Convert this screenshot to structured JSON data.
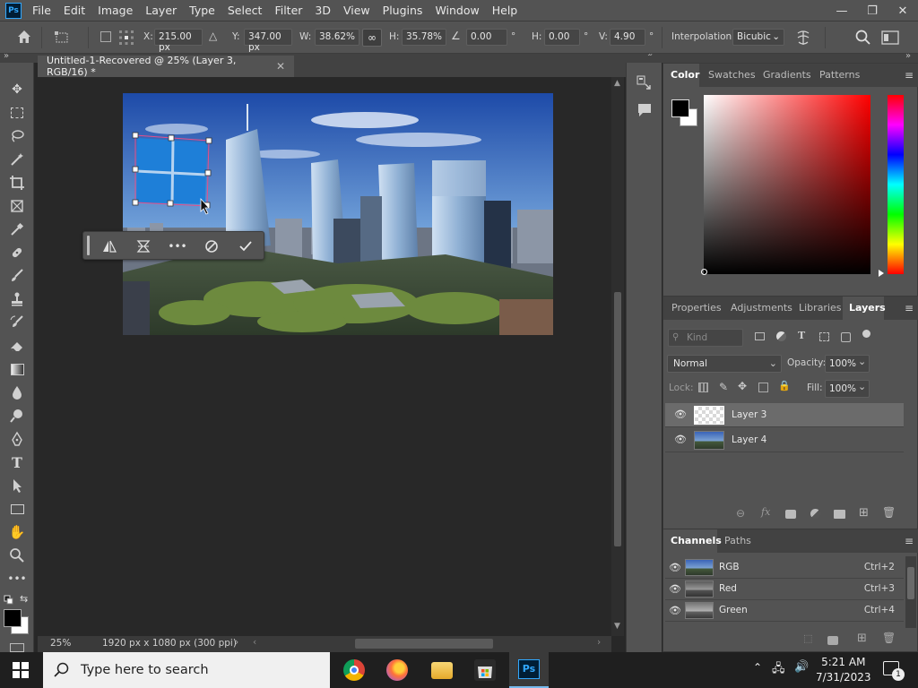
{
  "app": {
    "logo": "Ps"
  },
  "menu": [
    "File",
    "Edit",
    "Image",
    "Layer",
    "Type",
    "Select",
    "Filter",
    "3D",
    "View",
    "Plugins",
    "Window",
    "Help"
  ],
  "window_controls": {
    "minimize": "—",
    "restore": "❐",
    "close": "✕"
  },
  "options": {
    "x_label": "X:",
    "x_value": "215.00 px",
    "y_label": "Y:",
    "y_value": "347.00 px",
    "w_label": "W:",
    "w_value": "38.62%",
    "h_label": "H:",
    "h_value": "35.78%",
    "angle_value": "0.00",
    "deg": "°",
    "hskew_label": "H:",
    "hskew_value": "0.00",
    "vskew_label": "V:",
    "vskew_value": "4.90",
    "interp_label": "Interpolation:",
    "interp_value": "Bicubic"
  },
  "document": {
    "tab_title": "Untitled-1-Recovered @ 25% (Layer 3, RGB/16) *",
    "close": "✕",
    "zoom": "25%",
    "size_info": "1920 px x 1080 px (300 ppi)"
  },
  "context_bar": {
    "icons": [
      "flip-horizontal-icon",
      "warp-icon",
      "more-icon",
      "cancel-icon",
      "commit-icon"
    ]
  },
  "panels": {
    "color_tabs": [
      "Color",
      "Swatches",
      "Gradients",
      "Patterns"
    ],
    "layers_tabs": [
      "Properties",
      "Adjustments",
      "Libraries",
      "Layers"
    ],
    "kind_placeholder": "Kind",
    "blend_mode": "Normal",
    "opacity_label": "Opacity:",
    "opacity_value": "100%",
    "lock_label": "Lock:",
    "fill_label": "Fill:",
    "fill_value": "100%",
    "layers": [
      {
        "name": "Layer 3"
      },
      {
        "name": "Layer 4"
      }
    ],
    "channels_tabs": [
      "Channels",
      "Paths"
    ],
    "channels": [
      {
        "name": "RGB",
        "shortcut": "Ctrl+2"
      },
      {
        "name": "Red",
        "shortcut": "Ctrl+3"
      },
      {
        "name": "Green",
        "shortcut": "Ctrl+4"
      }
    ]
  },
  "taskbar": {
    "search_placeholder": "Type here to search",
    "time": "5:21 AM",
    "date": "7/31/2023",
    "notifications": "1"
  },
  "colors": {
    "ps_blue": "#31a8ff",
    "windows_logo": "#1e7fd8",
    "panel": "#535353",
    "canvas_bg": "#282828"
  }
}
